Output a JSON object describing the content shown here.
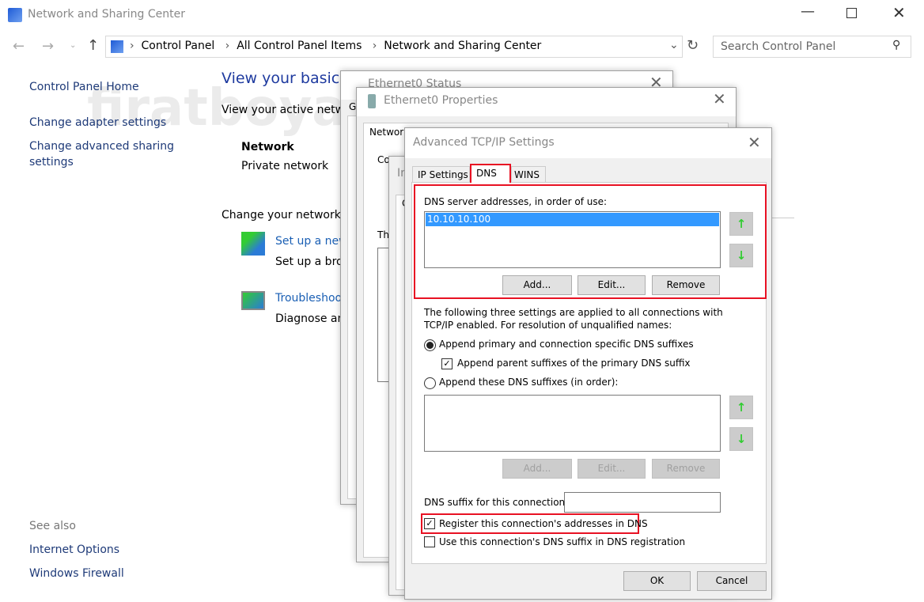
{
  "window": {
    "title": "Network and Sharing Center"
  },
  "address": {
    "crumbs": [
      "Control Panel",
      "All Control Panel Items",
      "Network and Sharing Center"
    ],
    "search_placeholder": "Search Control Panel"
  },
  "watermark": "firatboyan.com",
  "left": {
    "home": "Control Panel Home",
    "items": [
      "Change adapter settings",
      "Change advanced sharing",
      "settings"
    ],
    "see_also": "See also",
    "see_items": [
      "Internet Options",
      "Windows Firewall"
    ]
  },
  "main": {
    "title": "View your basic n",
    "active": "View your active netwo",
    "network_name": "Network",
    "network_type": "Private network",
    "change": "Change your networkin",
    "setup_link": "Set up a new",
    "setup_desc": "Set up a broa",
    "trouble_link": "Troubleshoo",
    "trouble_desc": "Diagnose an"
  },
  "status_dialog": {
    "title": "Ethernet0 Status",
    "tab": "G"
  },
  "props_dialog": {
    "title": "Ethernet0 Properties",
    "tab": "Network",
    "conn": "Conn",
    "this": "Th",
    "desc": "D"
  },
  "ipv4_dialog": {
    "title": "In",
    "tab": "G"
  },
  "adv": {
    "title": "Advanced TCP/IP Settings",
    "tabs": [
      "IP Settings",
      "DNS",
      "WINS"
    ],
    "dns_label": "DNS server addresses, in order of use:",
    "dns_servers": [
      "10.10.10.100"
    ],
    "add": "Add...",
    "edit": "Edit...",
    "remove": "Remove",
    "info1": "The following three settings are applied to all connections with",
    "info2": "TCP/IP enabled. For resolution of unqualified names:",
    "radio1": "Append primary and connection specific DNS suffixes",
    "check_parent": "Append parent suffixes of the primary DNS suffix",
    "radio2": "Append these DNS suffixes (in order):",
    "suffix_label": "DNS suffix for this connection:",
    "suffix_value": "",
    "register": "Register this connection's addresses in DNS",
    "use_suffix": "Use this connection's DNS suffix in DNS registration",
    "ok": "OK",
    "cancel": "Cancel",
    "highlight": "#e81123",
    "selection": "#3399ff"
  }
}
